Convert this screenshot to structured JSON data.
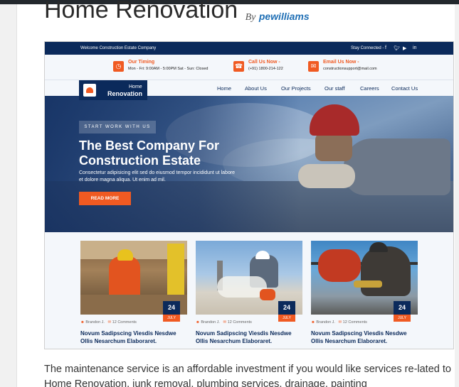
{
  "post": {
    "title": "Home Renovation",
    "by_label": "By",
    "author": "pewilliams"
  },
  "theme": {
    "navy": "#0b2a5b",
    "orange": "#f05a22"
  },
  "preview": {
    "top_strip": {
      "welcome": "Welcome Construction Estate Company",
      "stay_connected": "Stay Connected -",
      "social_icons": [
        "facebook-icon",
        "twitter-icon",
        "youtube-icon",
        "linkedin-icon"
      ]
    },
    "info": [
      {
        "icon": "clock-icon",
        "heading": "Our Timing",
        "detail": "Mon - Fri: 9:00AM - 5:00PM  Sat - Sun: Closed"
      },
      {
        "icon": "phone-icon",
        "heading": "Call Us Now -",
        "detail": "(+91) 1800-214-122"
      },
      {
        "icon": "mail-icon",
        "heading": "Email Us Now -",
        "detail": "constructionsupport@mail.com"
      }
    ],
    "logo": {
      "line1": "Home",
      "line2": "Renovation"
    },
    "menu": [
      "Home",
      "About Us",
      "Our Projects",
      "Our staff",
      "Careers",
      "Contact Us"
    ],
    "hero": {
      "tag": "START WORK WITH US",
      "heading": "The Best Company For Construction Estate",
      "text": "Consectetur adipisicing elit sed do eiusmod tempor incididunt ut labore et dolore magna aliqua. Ut enim ad mil.",
      "button": "READ MORE"
    },
    "cards": [
      {
        "day": "24",
        "month": "JULY",
        "author": "Brandon J.",
        "comments": "12 Comments",
        "title": "Novum Sadipscing Viesdis Nesdwe Ollis Nesarchum Elaboraret."
      },
      {
        "day": "24",
        "month": "JULY",
        "author": "Brandon J.",
        "comments": "12 Comments",
        "title": "Novum Sadipscing Viesdis Nesdwe Ollis Nesarchum Elaboraret."
      },
      {
        "day": "24",
        "month": "JULY",
        "author": "Brandon J.",
        "comments": "12 Comments",
        "title": "Novum Sadipscing Viesdis Nesdwe Ollis Nesarchum Elaboraret."
      }
    ]
  },
  "description": "The maintenance service is an affordable investment if you would like services re-lated to Home Renovation, junk removal, plumbing services, drainage, painting"
}
